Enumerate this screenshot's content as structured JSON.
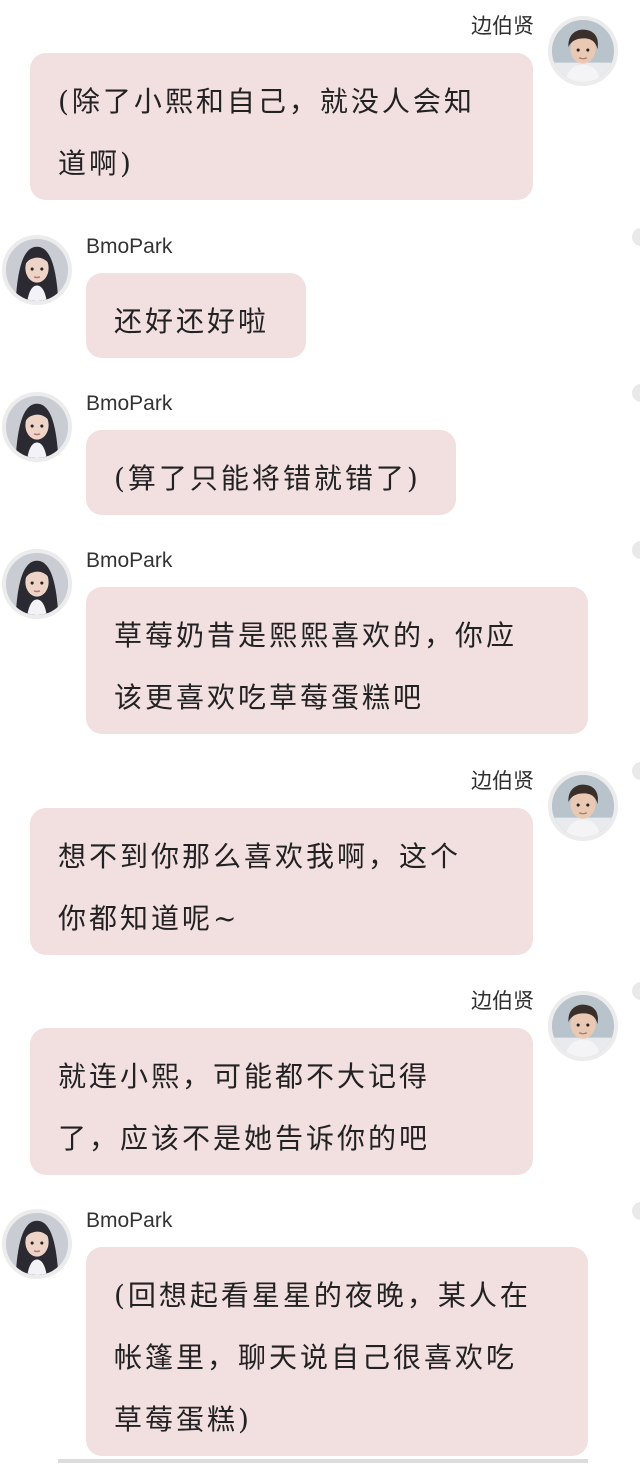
{
  "participants": {
    "me": {
      "name": "边伯贤",
      "avatar_icon": "male-user-avatar-icon"
    },
    "other": {
      "name": "BmoPark",
      "avatar_icon": "female-user-avatar-icon"
    }
  },
  "colors": {
    "bubble": "#f2dfe0",
    "background": "#ffffff",
    "text": "#222222"
  },
  "messages": [
    {
      "sender": "边伯贤",
      "side": "right",
      "lines": [
        "(除了小熙和自己，就没人会知",
        "道啊)"
      ]
    },
    {
      "sender": "BmoPark",
      "side": "left",
      "lines": [
        "还好还好啦"
      ]
    },
    {
      "sender": "BmoPark",
      "side": "left",
      "lines": [
        "(算了只能将错就错了)"
      ]
    },
    {
      "sender": "BmoPark",
      "side": "left",
      "lines": [
        "草莓奶昔是熙熙喜欢的，你应",
        "该更喜欢吃草莓蛋糕吧"
      ]
    },
    {
      "sender": "边伯贤",
      "side": "right",
      "lines": [
        "想不到你那么喜欢我啊，这个",
        "你都知道呢~"
      ]
    },
    {
      "sender": "边伯贤",
      "side": "right",
      "lines": [
        "就连小熙，可能都不大记得",
        "了，应该不是她告诉你的吧"
      ]
    },
    {
      "sender": "BmoPark",
      "side": "left",
      "lines": [
        "(回想起看星星的夜晚，某人在",
        "帐篷里，聊天说自己很喜欢吃",
        "草莓蛋糕)"
      ]
    }
  ]
}
